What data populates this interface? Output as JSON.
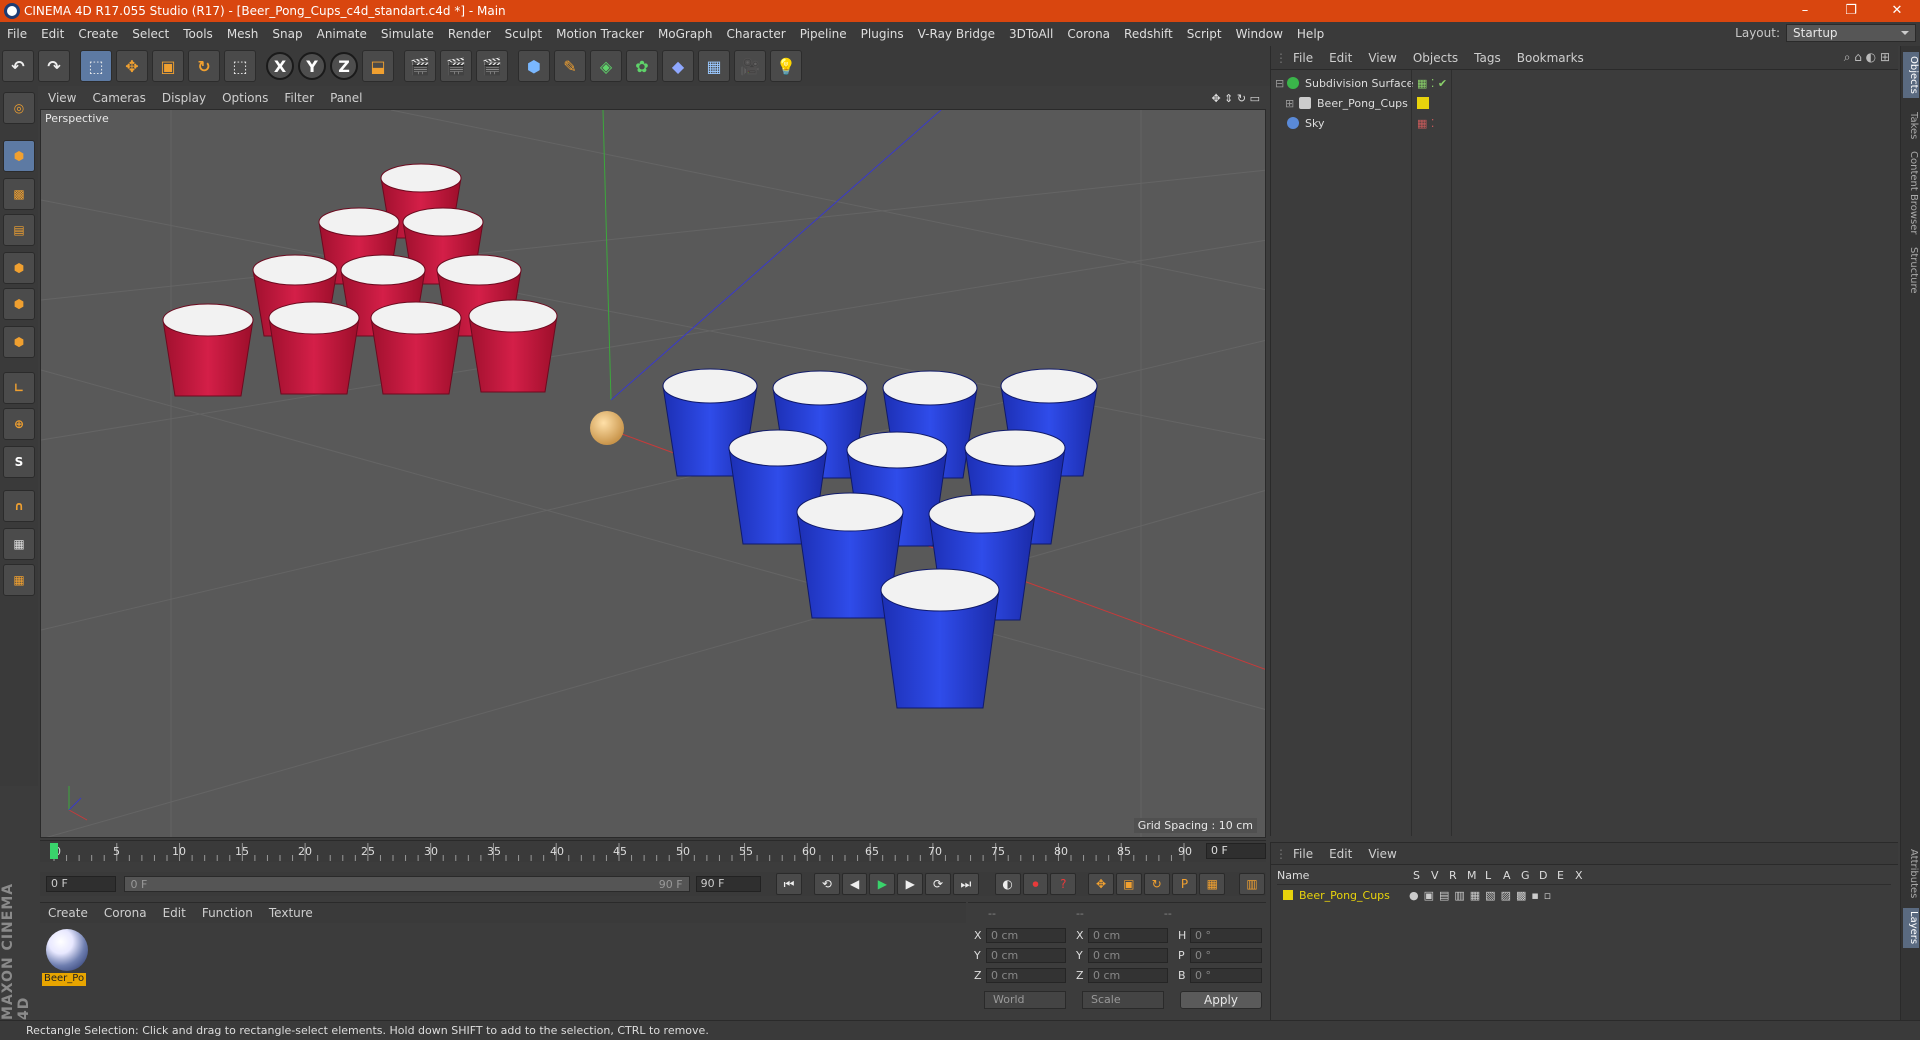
{
  "window": {
    "title": "CINEMA 4D R17.055 Studio (R17) - [Beer_Pong_Cups_c4d_standart.c4d *] - Main",
    "min": "–",
    "max": "❐",
    "close": "✕"
  },
  "menu": [
    "File",
    "Edit",
    "Create",
    "Select",
    "Tools",
    "Mesh",
    "Snap",
    "Animate",
    "Simulate",
    "Render",
    "Sculpt",
    "Motion Tracker",
    "MoGraph",
    "Character",
    "Pipeline",
    "Plugins",
    "V-Ray Bridge",
    "3DToAll",
    "Corona",
    "Redshift",
    "Script",
    "Window",
    "Help"
  ],
  "layout": {
    "label": "Layout:",
    "value": "Startup"
  },
  "toolbar": {
    "axis_x": "X",
    "axis_y": "Y",
    "axis_z": "Z"
  },
  "viewport": {
    "menu": [
      "View",
      "Cameras",
      "Display",
      "Options",
      "Filter",
      "Panel"
    ],
    "label": "Perspective",
    "grid_spacing": "Grid Spacing : 10 cm"
  },
  "timeline": {
    "ticks": [
      "0",
      "5",
      "10",
      "15",
      "20",
      "25",
      "30",
      "35",
      "40",
      "45",
      "50",
      "55",
      "60",
      "65",
      "70",
      "75",
      "80",
      "85",
      "90"
    ],
    "current": "0 F"
  },
  "transport": {
    "start": "0 F",
    "range_start": "0 F",
    "range_end": "90 F",
    "end": "90 F"
  },
  "material": {
    "menu": [
      "Create",
      "Corona",
      "Edit",
      "Function",
      "Texture"
    ],
    "name": "Beer_Po"
  },
  "coords": {
    "dashes": [
      "--",
      "--",
      "--"
    ],
    "rows": [
      {
        "a": "X",
        "v1": "0 cm",
        "b": "X",
        "v2": "0 cm",
        "c": "H",
        "v3": "0 °"
      },
      {
        "a": "Y",
        "v1": "0 cm",
        "b": "Y",
        "v2": "0 cm",
        "c": "P",
        "v3": "0 °"
      },
      {
        "a": "Z",
        "v1": "0 cm",
        "b": "Z",
        "v2": "0 cm",
        "c": "B",
        "v3": "0 °"
      }
    ],
    "world": "World",
    "scale": "Scale",
    "apply": "Apply"
  },
  "objects": {
    "menu": [
      "File",
      "Edit",
      "View",
      "Objects",
      "Tags",
      "Bookmarks"
    ],
    "items": [
      {
        "name": "Subdivision Surface",
        "color": "#3ab54a"
      },
      {
        "name": "Beer_Pong_Cups",
        "color": "#cccccc"
      },
      {
        "name": "Sky",
        "color": "#5a8ad8"
      }
    ]
  },
  "layers": {
    "menu": [
      "File",
      "Edit",
      "View"
    ],
    "head": [
      "Name",
      "S",
      "V",
      "R",
      "M",
      "L",
      "A",
      "G",
      "D",
      "E",
      "X"
    ],
    "row": "Beer_Pong_Cups"
  },
  "sidetabs": [
    "Objects",
    "Takes",
    "Content Browser",
    "Structure",
    "Attributes",
    "Layers"
  ],
  "brand": "MAXON CINEMA 4D",
  "status": "Rectangle Selection: Click and drag to rectangle-select elements. Hold down SHIFT to add to the selection, CTRL to remove."
}
